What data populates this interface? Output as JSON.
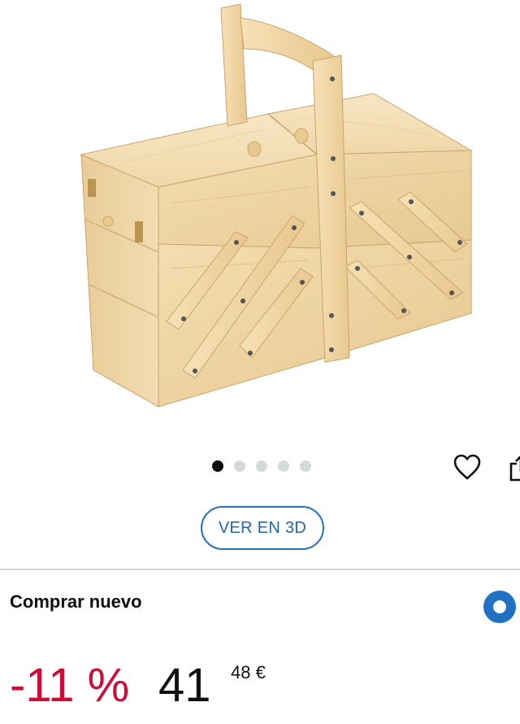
{
  "product": {
    "image_icon": "wooden-sewing-box-image"
  },
  "carousel": {
    "dot_count": 5,
    "active_index": 0
  },
  "actions": {
    "wishlist_icon": "heart-outline-icon",
    "share_icon": "share-icon",
    "view_3d_label": "VER EN 3D"
  },
  "purchase": {
    "option_label": "Comprar nuevo",
    "selected": true,
    "discount": "-11 %",
    "price_whole": "41",
    "price_fraction": "48 €"
  },
  "colors": {
    "accent_blue": "#2070c4",
    "discount_red": "#cc0c39"
  }
}
